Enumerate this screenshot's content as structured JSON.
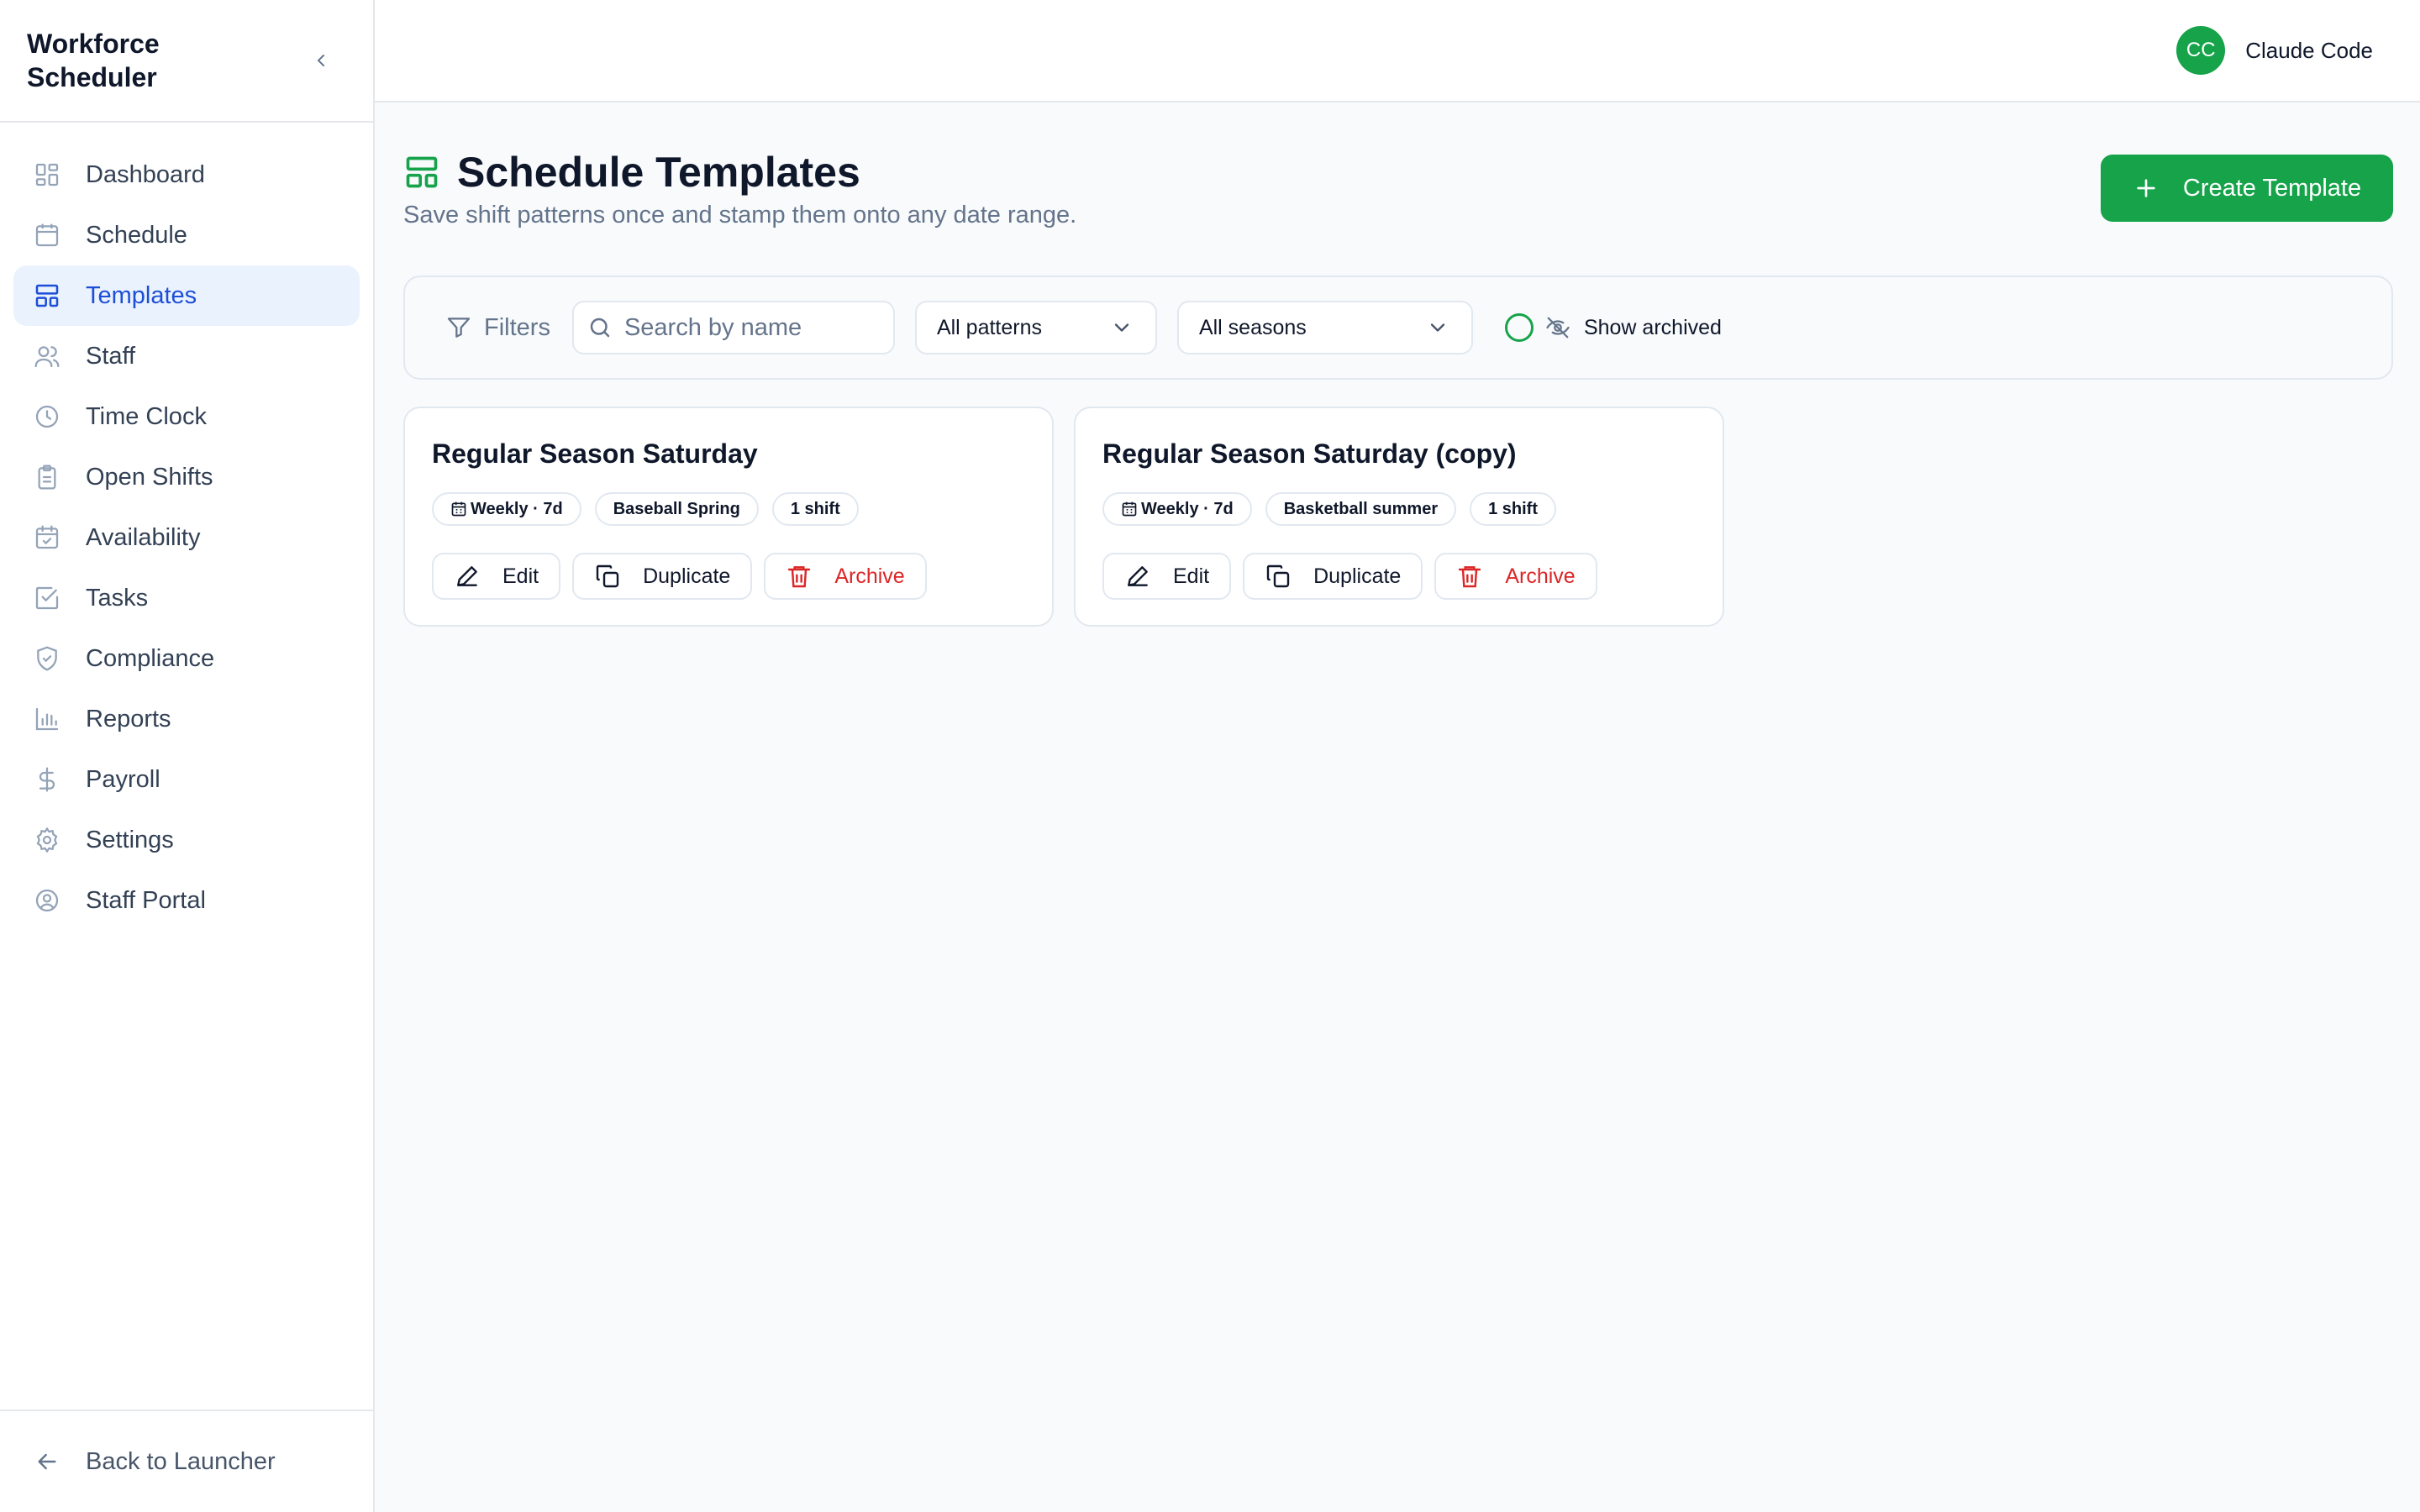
{
  "app": {
    "title": "Workforce Scheduler"
  },
  "sidebar": {
    "items": [
      {
        "label": "Dashboard",
        "icon": "dashboard-icon"
      },
      {
        "label": "Schedule",
        "icon": "calendar-icon"
      },
      {
        "label": "Templates",
        "icon": "layout-template-icon",
        "active": true
      },
      {
        "label": "Staff",
        "icon": "users-icon"
      },
      {
        "label": "Time Clock",
        "icon": "clock-icon"
      },
      {
        "label": "Open Shifts",
        "icon": "clipboard-icon"
      },
      {
        "label": "Availability",
        "icon": "calendar-check-icon"
      },
      {
        "label": "Tasks",
        "icon": "check-square-icon"
      },
      {
        "label": "Compliance",
        "icon": "shield-check-icon"
      },
      {
        "label": "Reports",
        "icon": "bar-chart-icon"
      },
      {
        "label": "Payroll",
        "icon": "dollar-icon"
      },
      {
        "label": "Settings",
        "icon": "gear-icon"
      },
      {
        "label": "Staff Portal",
        "icon": "user-circle-icon"
      }
    ],
    "footer_label": "Back to Launcher"
  },
  "topbar": {
    "avatar_initials": "CC",
    "user_name": "Claude Code"
  },
  "page": {
    "title": "Schedule Templates",
    "subtitle": "Save shift patterns once and stamp them onto any date range.",
    "create_label": "Create Template"
  },
  "filters": {
    "label": "Filters",
    "search_placeholder": "Search by name",
    "pattern_value": "All patterns",
    "season_value": "All seasons",
    "show_archived_label": "Show archived"
  },
  "templates": [
    {
      "name": "Regular Season Saturday",
      "pattern": "Weekly · 7d",
      "season": "Baseball Spring",
      "shifts": "1 shift",
      "edit_label": "Edit",
      "duplicate_label": "Duplicate",
      "archive_label": "Archive"
    },
    {
      "name": "Regular Season Saturday (copy)",
      "pattern": "Weekly · 7d",
      "season": "Basketball summer",
      "shifts": "1 shift",
      "edit_label": "Edit",
      "duplicate_label": "Duplicate",
      "archive_label": "Archive"
    }
  ],
  "colors": {
    "accent_green": "#16a34a",
    "active_blue": "#1d4ed8",
    "active_bg": "#eaf2fd",
    "danger_red": "#dc2626"
  }
}
